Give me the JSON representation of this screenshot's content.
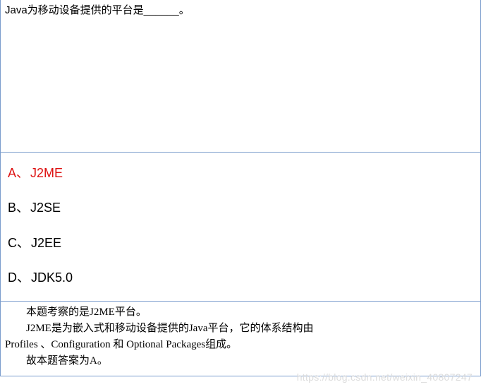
{
  "question": {
    "text": "Java为移动设备提供的平台是______。"
  },
  "answers": [
    {
      "label": "A",
      "sep": "、",
      "text": "J2ME",
      "correct": true
    },
    {
      "label": "B",
      "sep": "、",
      "text": "J2SE",
      "correct": false
    },
    {
      "label": "C",
      "sep": "、",
      "text": "J2EE",
      "correct": false
    },
    {
      "label": "D",
      "sep": "、",
      "text": "JDK5.0",
      "correct": false
    }
  ],
  "explanation": {
    "line1": "本题考察的是J2ME平台。",
    "line2": "J2ME是为嵌入式和移动设备提供的Java平台，它的体系结构由",
    "line3": "Profiles 、Configuration 和 Optional Packages组成。",
    "line4": "故本题答案为A。"
  },
  "watermark": "https://blog.csdn.net/weixin_40807247"
}
